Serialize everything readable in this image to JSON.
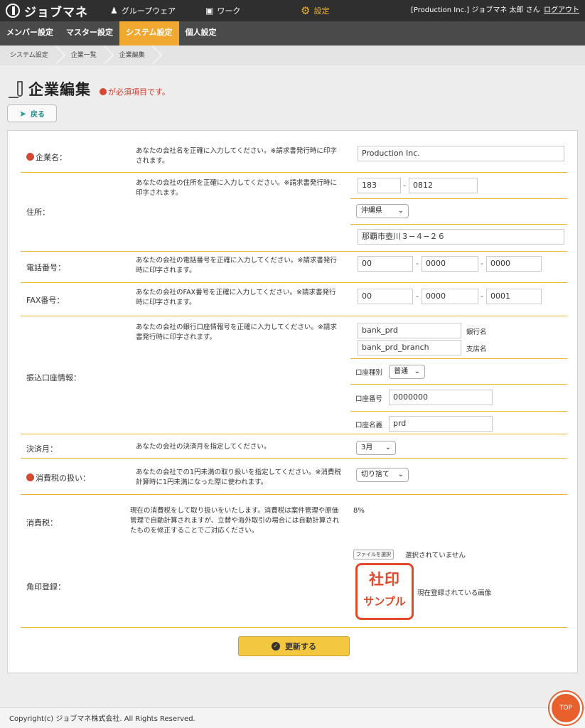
{
  "app": {
    "name": "ジョブマネ"
  },
  "topnav": {
    "groupware": "グループウェア",
    "work": "ワーク",
    "settings": "設定"
  },
  "user": {
    "info": "[Production Inc.] ジョブマネ 太郎 さん",
    "logout": "ログアウト"
  },
  "subnav": [
    "メンバー設定",
    "マスター設定",
    "システム設定",
    "個人設定"
  ],
  "breadcrumb": [
    "システム設定",
    "企業一覧",
    "企業編集"
  ],
  "page": {
    "title": "企業編集",
    "required_note": "が必須項目です。",
    "back": "戻る"
  },
  "form": {
    "company_name": {
      "label": "企業名：",
      "desc": "あなたの会社名を正確に入力してください。※請求書発行時に印字されます。",
      "value": "Production Inc."
    },
    "address": {
      "label": "住所：",
      "desc": "あなたの会社の住所を正確に入力してください。※請求書発行時に印字されます。",
      "zip1": "183",
      "zip2": "0812",
      "prefecture": "沖縄県",
      "street": "那覇市壺川３−４−２６"
    },
    "phone": {
      "label": "電話番号：",
      "desc": "あなたの会社の電話番号を正確に入力してください。※請求書発行時に印字されます。",
      "p1": "00",
      "p2": "0000",
      "p3": "0000"
    },
    "fax": {
      "label": "FAX番号：",
      "desc": "あなたの会社のFAX番号を正確に入力してください。※請求書発行時に印字されます。",
      "p1": "00",
      "p2": "0000",
      "p3": "0001"
    },
    "bank": {
      "label": "振込口座情報：",
      "desc": "あなたの会社の銀行口座情報号を正確に入力してください。※請求書発行時に印字されます。",
      "bank_name": "bank_prd",
      "bank_name_label": "銀行名",
      "branch_name": "bank_prd_branch",
      "branch_name_label": "支店名",
      "type_label": "口座種別",
      "type_value": "普通",
      "number_label": "口座番号",
      "number_value": "0000000",
      "holder_label": "口座名義",
      "holder_value": "prd"
    },
    "fiscal_month": {
      "label": "決済月：",
      "desc": "あなたの会社の決済月を指定してください。",
      "value": "3月"
    },
    "tax_rounding": {
      "label": "消費税の扱い：",
      "desc": "あなたの会社での1円未満の取り扱いを指定してください。※消費税計算時に1円未満になった際に使われます。",
      "value": "切り捨て"
    },
    "tax": {
      "label": "消費税：",
      "desc": "現在の消費税をして取り扱いをいたします。消費税は案件管理や原価管理で自動計算されますが、立替や海外取引の場合には自動計算されたものを修正することでご対応ください。",
      "value": "8%"
    },
    "seal": {
      "label": "角印登録：",
      "file_button": "ファイルを選択",
      "file_status": "選択されていません",
      "sample_top": "社印",
      "sample_bottom": "サンプル",
      "caption": "現在登録されている画像"
    },
    "submit": "更新する"
  },
  "footer": {
    "copyright": "Copyright(c) ジョブマネ株式会社. All Rights Reserved.",
    "top": "TOP"
  },
  "colors": {
    "accent": "#f0a830",
    "required": "#d6482f",
    "seal": "#e04a2c",
    "submit": "#f3c73f"
  }
}
